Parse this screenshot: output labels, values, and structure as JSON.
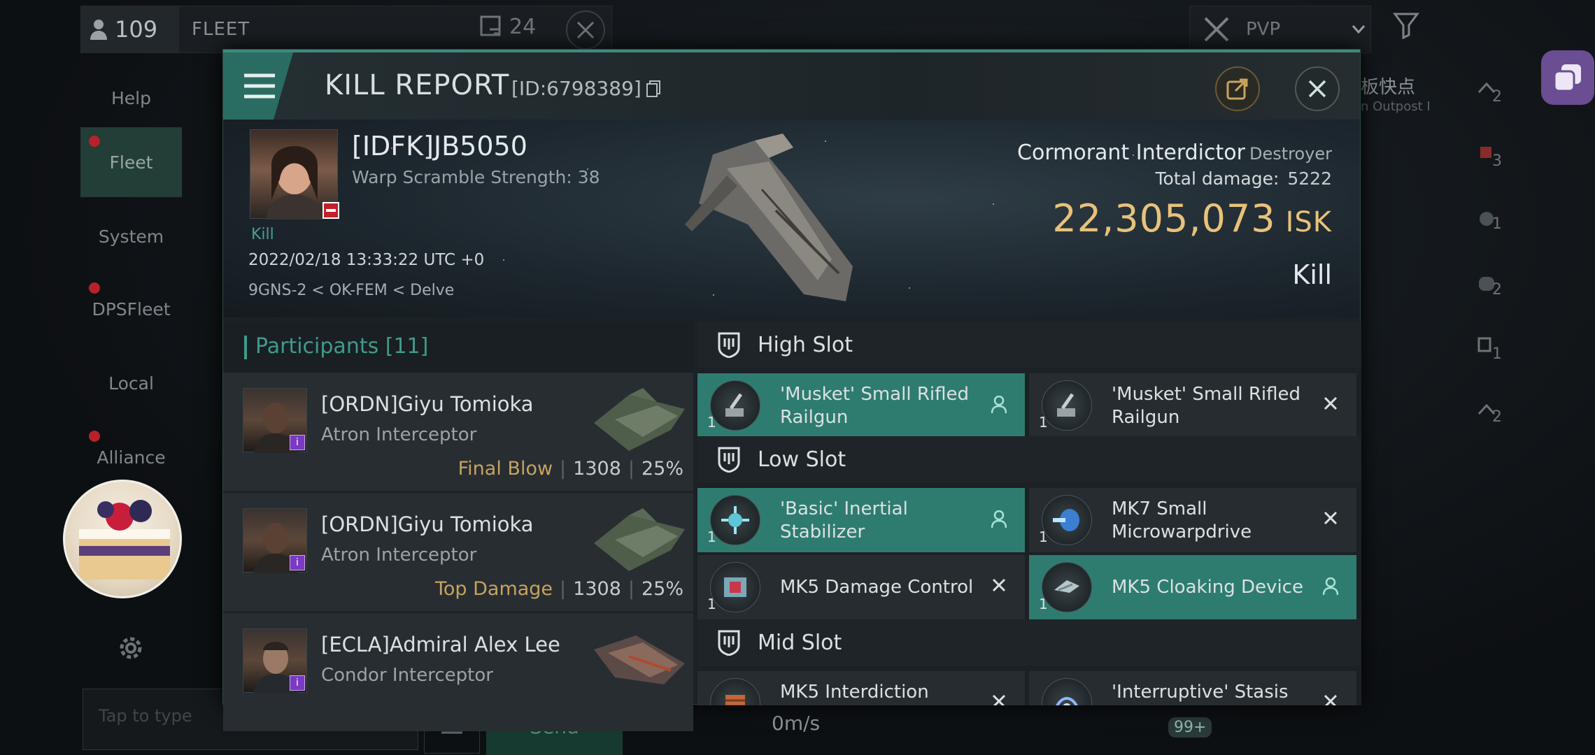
{
  "background": {
    "member_count": "109",
    "fleet_tab": "FLEET",
    "message_count": "24",
    "pvp_filter": "PVP",
    "station_label_cn": "板快点",
    "station_sub": "n Outpost I",
    "speed": "0m/s",
    "chat_placeholder": "Tap to type",
    "send_label": "Send",
    "badge_count": "99+",
    "right_icon_counts": [
      "2",
      "3",
      "1",
      "2",
      "1",
      "2"
    ]
  },
  "sidebar": {
    "items": [
      {
        "label": "Help"
      },
      {
        "label": "Fleet"
      },
      {
        "label": "System"
      },
      {
        "label": "DPSFleet"
      },
      {
        "label": "Local"
      },
      {
        "label": "Alliance"
      }
    ]
  },
  "report": {
    "title": "KILL REPORT",
    "id": "[ID:6798389]",
    "accent_color": "#3e8a7e",
    "victim": {
      "name": "[IDFK]JB5050",
      "warp_scramble": "Warp Scramble Strength: 38",
      "kill_tag": "Kill",
      "timestamp": "2022/02/18 13:33:22 UTC +0",
      "location": "9GNS-2 < OK-FEM < Delve",
      "ship": "Cormorant Interdictor",
      "ship_class": "Destroyer",
      "total_damage_label": "Total damage:",
      "total_damage": "5222",
      "isk_value": "22,305,073",
      "isk_unit": "ISK",
      "result": "Kill"
    },
    "participants_header": "Participants [11]",
    "participants": [
      {
        "name": "[ORDN]Giyu Tomioka",
        "ship": "Atron Interceptor",
        "label": "Final Blow",
        "damage": "1308",
        "percent": "25%"
      },
      {
        "name": "[ORDN]Giyu Tomioka",
        "ship": "Atron Interceptor",
        "label": "Top Damage",
        "damage": "1308",
        "percent": "25%"
      },
      {
        "name": "[ECLA]Admiral Alex Lee",
        "ship": "Condor Interceptor",
        "label": "",
        "damage": "",
        "percent": ""
      }
    ],
    "slots": {
      "high": {
        "label": "High Slot",
        "modules": [
          {
            "name": "'Musket' Small Rifled Railgun",
            "qty": "1",
            "state": "dropped",
            "icon": "railgun-icon"
          },
          {
            "name": "'Musket' Small Rifled Railgun",
            "qty": "1",
            "state": "destroyed",
            "icon": "railgun-icon"
          }
        ]
      },
      "low": {
        "label": "Low Slot",
        "modules": [
          {
            "name": "'Basic' Inertial Stabilizer",
            "qty": "1",
            "state": "dropped",
            "icon": "stabilizer-icon"
          },
          {
            "name": "MK7 Small Microwarpdrive",
            "qty": "1",
            "state": "destroyed",
            "icon": "microwarpdrive-icon"
          },
          {
            "name": "MK5 Damage Control",
            "qty": "1",
            "state": "destroyed",
            "icon": "damage-control-icon"
          },
          {
            "name": "MK5 Cloaking Device",
            "qty": "1",
            "state": "dropped",
            "icon": "cloaking-icon"
          }
        ]
      },
      "mid": {
        "label": "Mid Slot",
        "modules": [
          {
            "name": "MK5 Interdiction",
            "qty": "1",
            "state": "destroyed",
            "icon": "interdiction-icon"
          },
          {
            "name": "'Interruptive' Stasis",
            "qty": "1",
            "state": "destroyed",
            "icon": "stasis-icon"
          }
        ]
      }
    }
  }
}
